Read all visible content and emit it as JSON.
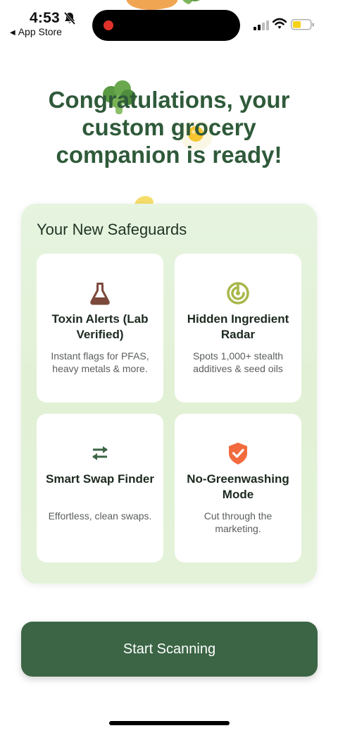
{
  "status_bar": {
    "time": "4:53",
    "back_app": "App Store",
    "back_arrow": "◀",
    "icons": [
      "bell-slash-icon",
      "recording-dot-icon",
      "signal-icon",
      "wifi-icon",
      "battery-low-power-icon"
    ]
  },
  "headline": "Congratulations, your custom grocery companion is ready!",
  "safeguards": {
    "title": "Your New Safeguards",
    "cards": [
      {
        "icon": "flask-icon",
        "title": "Toxin Alerts (Lab Verified)",
        "description": "Instant flags for PFAS, heavy metals & more."
      },
      {
        "icon": "radar-icon",
        "title": "Hidden Ingredient Radar",
        "description": "Spots 1,000+ stealth additives & seed oils"
      },
      {
        "icon": "swap-arrows-icon",
        "title": "Smart Swap Finder",
        "description": "Effortless, clean swaps."
      },
      {
        "icon": "shield-check-icon",
        "title": "No-Greenwashing Mode",
        "description": "Cut through the marketing."
      }
    ]
  },
  "cta": {
    "label": "Start Scanning"
  },
  "colors": {
    "brand_green": "#3b6545",
    "headline_green": "#2f5a3a",
    "panel_background": "#e4f3db",
    "flask_brown": "#7b4a3a",
    "radar_olive": "#a9b74a",
    "swap_green": "#3b6545",
    "shield_orange": "#f26a3d",
    "battery_yellow": "#f5d21c",
    "record_red": "#e0322a"
  }
}
